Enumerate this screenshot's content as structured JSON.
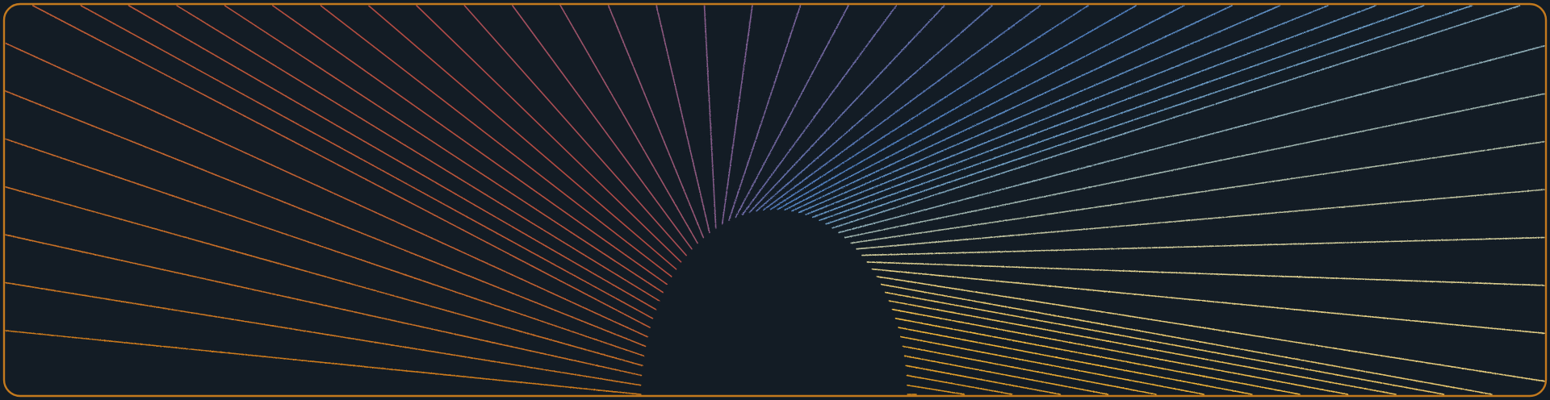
{
  "banner": {
    "background_color": "#131c25",
    "frame_color": "#c47a1e",
    "palette": [
      "#cf7b1f",
      "#bf5a35",
      "#b44a45",
      "#7f5f96",
      "#4f7fc0",
      "#6fa0c8",
      "#e3d38f",
      "#f2b63a",
      "#d9901f"
    ],
    "ray_count": 60
  }
}
